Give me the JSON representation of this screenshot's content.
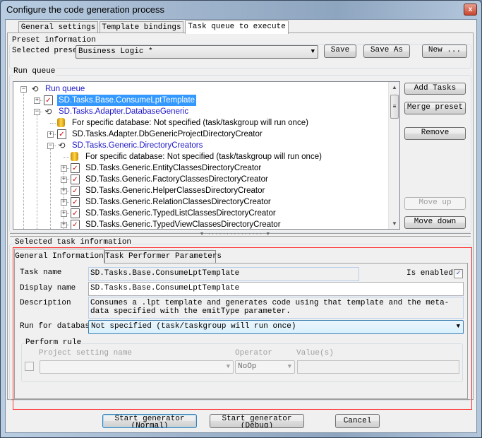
{
  "window": {
    "title": "Configure the code generation process",
    "close_label": "x"
  },
  "tabs": [
    {
      "label": "General settings"
    },
    {
      "label": "Template bindings"
    },
    {
      "label": "Task queue to execute",
      "selected": true
    }
  ],
  "preset": {
    "group_label": "Preset information",
    "selected_label": "Selected preset",
    "selected_value": "Business Logic *",
    "save": "Save",
    "save_as": "Save As",
    "new": "New ..."
  },
  "run_queue": {
    "group_label": "Run queue",
    "tree": [
      {
        "level": 0,
        "expander": "-",
        "icon": "group",
        "text": "Run queue",
        "style": "blue"
      },
      {
        "level": 1,
        "expander": "+",
        "icon": "task",
        "text": "SD.Tasks.Base.ConsumeLptTemplate",
        "style": "sel"
      },
      {
        "level": 1,
        "expander": "-",
        "icon": "group",
        "text": "SD.Tasks.Adapter.DatabaseGeneric",
        "style": "blue"
      },
      {
        "level": 2,
        "expander": "",
        "icon": "db",
        "text": "For specific database: Not specified (task/taskgroup will run once)",
        "style": ""
      },
      {
        "level": 2,
        "expander": "+",
        "icon": "task",
        "text": "SD.Tasks.Adapter.DbGenericProjectDirectoryCreator",
        "style": ""
      },
      {
        "level": 2,
        "expander": "-",
        "icon": "group",
        "text": "SD.Tasks.Generic.DirectoryCreators",
        "style": "blue"
      },
      {
        "level": 3,
        "expander": "",
        "icon": "db",
        "text": "For specific database: Not specified (task/taskgroup will run once)",
        "style": ""
      },
      {
        "level": 3,
        "expander": "+",
        "icon": "task",
        "text": "SD.Tasks.Generic.EntityClassesDirectoryCreator",
        "style": ""
      },
      {
        "level": 3,
        "expander": "+",
        "icon": "task",
        "text": "SD.Tasks.Generic.FactoryClassesDirectoryCreator",
        "style": ""
      },
      {
        "level": 3,
        "expander": "+",
        "icon": "task",
        "text": "SD.Tasks.Generic.HelperClassesDirectoryCreator",
        "style": ""
      },
      {
        "level": 3,
        "expander": "+",
        "icon": "task",
        "text": "SD.Tasks.Generic.RelationClassesDirectoryCreator",
        "style": ""
      },
      {
        "level": 3,
        "expander": "+",
        "icon": "task",
        "text": "SD.Tasks.Generic.TypedListClassesDirectoryCreator",
        "style": ""
      },
      {
        "level": 3,
        "expander": "+",
        "icon": "task",
        "text": "SD.Tasks.Generic.TypedViewClassesDirectoryCreator",
        "style": ""
      }
    ],
    "buttons": {
      "add_tasks": "Add Tasks",
      "merge_preset": "Merge preset",
      "remove": "Remove",
      "move_up": "Move up",
      "move_down": "Move down"
    }
  },
  "selected_task": {
    "group_label": "Selected task information",
    "tabs": [
      {
        "label": "General Information",
        "selected": true
      },
      {
        "label": "Task Performer Parameters"
      }
    ],
    "task_name_label": "Task name",
    "task_name": "SD.Tasks.Base.ConsumeLptTemplate",
    "is_enabled_label": "Is enabled",
    "is_enabled": true,
    "display_name_label": "Display name",
    "display_name": "SD.Tasks.Base.ConsumeLptTemplate",
    "description_label": "Description",
    "description": "Consumes a .lpt template and generates code using that template and the meta-data specified with the emitType parameter.",
    "run_for_database_label": "Run for database",
    "run_for_database": "Not specified (task/taskgroup will run once)",
    "perform_rule": {
      "group_label": "Perform rule",
      "project_setting_label": "Project setting name",
      "operator_label": "Operator",
      "operator_value": "NoOp",
      "values_label": "Value(s)",
      "enabled": false
    }
  },
  "footer": {
    "start_normal": "Start generator (Normal)",
    "start_debug": "Start generator (Debug)",
    "cancel": "Cancel"
  },
  "colors": {
    "selection": "#3399ff",
    "group_text": "#1e18c8",
    "highlight_border": "#ff3333"
  }
}
